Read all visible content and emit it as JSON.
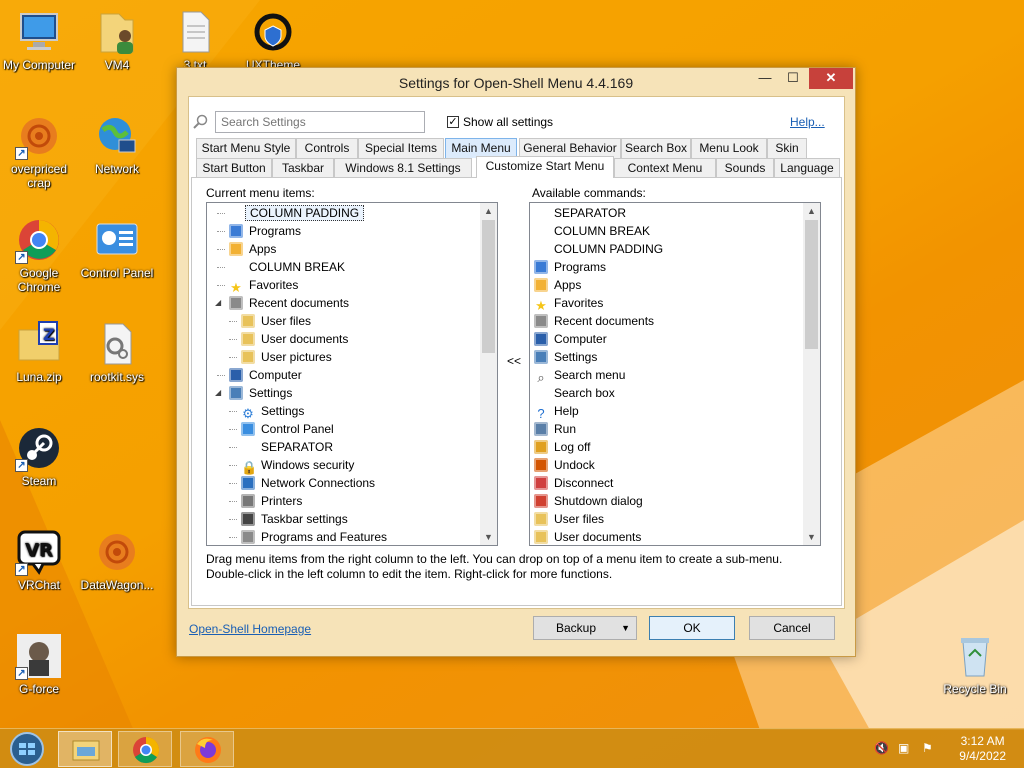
{
  "desktop": {
    "icons": [
      {
        "label": "My Computer"
      },
      {
        "label": "VM4"
      },
      {
        "label": "3.txt"
      },
      {
        "label": "UXTheme Multi-Patch..."
      },
      {
        "label": "overpriced crap"
      },
      {
        "label": "Network"
      },
      {
        "label": "Google Chrome"
      },
      {
        "label": "Control Panel"
      },
      {
        "label": "Luna.zip"
      },
      {
        "label": "rootkit.sys"
      },
      {
        "label": "Steam"
      },
      {
        "label": "VRChat"
      },
      {
        "label": "DataWagon..."
      },
      {
        "label": "G-force"
      },
      {
        "label": "Recycle Bin"
      }
    ]
  },
  "window": {
    "title": "Settings for Open-Shell Menu 4.4.169",
    "caption": {
      "minimize": "—",
      "maximize": "☐",
      "close": "✕"
    },
    "search_placeholder": "Search Settings",
    "show_all_label": "Show all settings",
    "show_all_checked": true,
    "help_link": "Help...",
    "tabs_row1": [
      "Start Menu Style",
      "Controls",
      "Special Items",
      "Main Menu",
      "General Behavior",
      "Search Box",
      "Menu Look",
      "Skin"
    ],
    "tabs_row2": [
      "Start Button",
      "Taskbar",
      "Windows 8.1 Settings",
      "Customize Start Menu",
      "Context Menu",
      "Sounds",
      "Language"
    ],
    "selected_tab": "Customize Start Menu",
    "left_heading": "Current menu items:",
    "right_heading": "Available commands:",
    "move_left": "<<",
    "current_items": [
      {
        "label": "COLUMN PADDING",
        "indent": 0,
        "icon": "none-icon",
        "selected": true
      },
      {
        "label": "Programs",
        "indent": 0,
        "icon": "programs-icon"
      },
      {
        "label": "Apps",
        "indent": 0,
        "icon": "apps-icon"
      },
      {
        "label": "COLUMN BREAK",
        "indent": 0,
        "icon": "none-icon"
      },
      {
        "label": "Favorites",
        "indent": 0,
        "icon": "star-icon"
      },
      {
        "label": "Recent documents",
        "indent": 0,
        "icon": "recent-icon",
        "expander": true
      },
      {
        "label": "User files",
        "indent": 1,
        "icon": "folder-user-icon"
      },
      {
        "label": "User documents",
        "indent": 1,
        "icon": "folder-docs-icon"
      },
      {
        "label": "User pictures",
        "indent": 1,
        "icon": "folder-pics-icon"
      },
      {
        "label": "Computer",
        "indent": 0,
        "icon": "computer-icon"
      },
      {
        "label": "Settings",
        "indent": 0,
        "icon": "settings-icon",
        "expander": true
      },
      {
        "label": "Settings",
        "indent": 1,
        "icon": "gear-icon"
      },
      {
        "label": "Control Panel",
        "indent": 1,
        "icon": "control-panel-icon"
      },
      {
        "label": "SEPARATOR",
        "indent": 1,
        "icon": "none-icon"
      },
      {
        "label": "Windows security",
        "indent": 1,
        "icon": "lock-icon"
      },
      {
        "label": "Network Connections",
        "indent": 1,
        "icon": "network-icon"
      },
      {
        "label": "Printers",
        "indent": 1,
        "icon": "printer-icon"
      },
      {
        "label": "Taskbar settings",
        "indent": 1,
        "icon": "taskbar-icon"
      },
      {
        "label": "Programs and Features",
        "indent": 1,
        "icon": "features-icon"
      }
    ],
    "available_commands": [
      {
        "label": "SEPARATOR",
        "icon": "none-icon"
      },
      {
        "label": "COLUMN BREAK",
        "icon": "none-icon"
      },
      {
        "label": "COLUMN PADDING",
        "icon": "none-icon"
      },
      {
        "label": "Programs",
        "icon": "programs-icon"
      },
      {
        "label": "Apps",
        "icon": "apps-icon"
      },
      {
        "label": "Favorites",
        "icon": "star-icon"
      },
      {
        "label": "Recent documents",
        "icon": "recent-icon"
      },
      {
        "label": "Computer",
        "icon": "computer-icon"
      },
      {
        "label": "Settings",
        "icon": "settings-icon"
      },
      {
        "label": "Search menu",
        "icon": "search-icon"
      },
      {
        "label": "Search box",
        "icon": "none-icon"
      },
      {
        "label": "Help",
        "icon": "help-icon"
      },
      {
        "label": "Run",
        "icon": "run-icon"
      },
      {
        "label": "Log off",
        "icon": "logoff-icon"
      },
      {
        "label": "Undock",
        "icon": "undock-icon"
      },
      {
        "label": "Disconnect",
        "icon": "disconnect-icon"
      },
      {
        "label": "Shutdown dialog",
        "icon": "shutdown-icon"
      },
      {
        "label": "User files",
        "icon": "folder-user-icon"
      },
      {
        "label": "User documents",
        "icon": "folder-docs-icon"
      }
    ],
    "hint_line1": "Drag menu items from the right column to the left. You can drop on top of a menu item to create a sub-menu.",
    "hint_line2": "Double-click in the left column to edit the item. Right-click for more functions.",
    "homepage_link": "Open-Shell Homepage",
    "backup_label": "Backup",
    "ok_label": "OK",
    "cancel_label": "Cancel"
  },
  "taskbar": {
    "time": "3:12 AM",
    "date": "9/4/2022"
  },
  "colors": {
    "desktop_bg": "#f5a000",
    "window_frame": "#f6e3b8",
    "close_button": "#c7413b",
    "link": "#1a5fb4",
    "selection_border": "#7eb4ea"
  }
}
